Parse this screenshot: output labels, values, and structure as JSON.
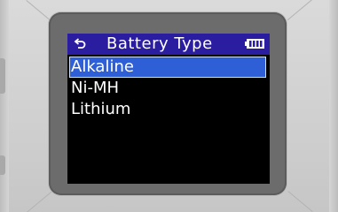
{
  "screen": {
    "title": "Battery Type",
    "icons": {
      "back": "back-arrow-icon",
      "battery": "battery-icon"
    },
    "menu_items": [
      {
        "label": "Alkaline",
        "selected": true
      },
      {
        "label": "Ni-MH",
        "selected": false
      },
      {
        "label": "Lithium",
        "selected": false
      }
    ]
  },
  "colors": {
    "title_bar": "#2a1da0",
    "selection": "#2f5fd6",
    "screen_bg": "#000000",
    "text": "#ffffff"
  }
}
